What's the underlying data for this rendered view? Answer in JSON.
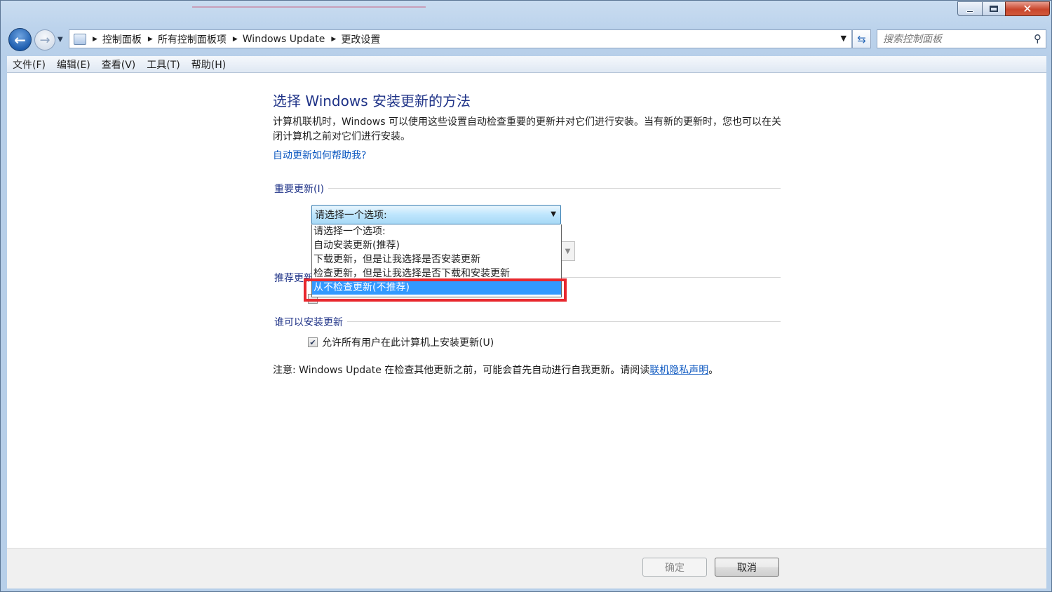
{
  "breadcrumb": {
    "items": [
      "控制面板",
      "所有控制面板项",
      "Windows Update",
      "更改设置"
    ]
  },
  "search": {
    "placeholder": "搜索控制面板"
  },
  "menu": {
    "items": [
      "文件(F)",
      "编辑(E)",
      "查看(V)",
      "工具(T)",
      "帮助(H)"
    ]
  },
  "page": {
    "heading": "选择 Windows 安装更新的方法",
    "description": "计算机联机时，Windows 可以使用这些设置自动检查重要的更新并对它们进行安装。当有新的更新时，您也可以在关闭计算机之前对它们进行安装。",
    "help_link": "自动更新如何帮助我?"
  },
  "important_updates": {
    "title": "重要更新(I)",
    "combo_value": "请选择一个选项:",
    "options": [
      "请选择一个选项:",
      "自动安装更新(推荐)",
      "下载更新，但是让我选择是否安装更新",
      "检查更新，但是让我选择是否下载和安装更新",
      "从不检查更新(不推荐)"
    ],
    "highlighted_index": 4
  },
  "recommended_updates": {
    "title_visible": "推荐更新"
  },
  "who_can_install": {
    "title": "谁可以安装更新",
    "checkbox_label": "允许所有用户在此计算机上安装更新(U)",
    "checked": true
  },
  "note": {
    "prefix": "注意: Windows Update 在检查其他更新之前，可能会首先自动进行自我更新。请阅读",
    "link": "联机隐私声明",
    "suffix": "。"
  },
  "footer": {
    "ok_label": "确定",
    "cancel_label": "取消"
  },
  "colors": {
    "accent_heading": "#1e3287",
    "link": "#0b57c0",
    "selection": "#3399ff",
    "highlight_box": "#e8282e"
  },
  "icons": {
    "back": "back-arrow-icon",
    "forward": "forward-arrow-icon",
    "refresh": "refresh-icon",
    "search": "search-icon",
    "close": "close-icon"
  }
}
